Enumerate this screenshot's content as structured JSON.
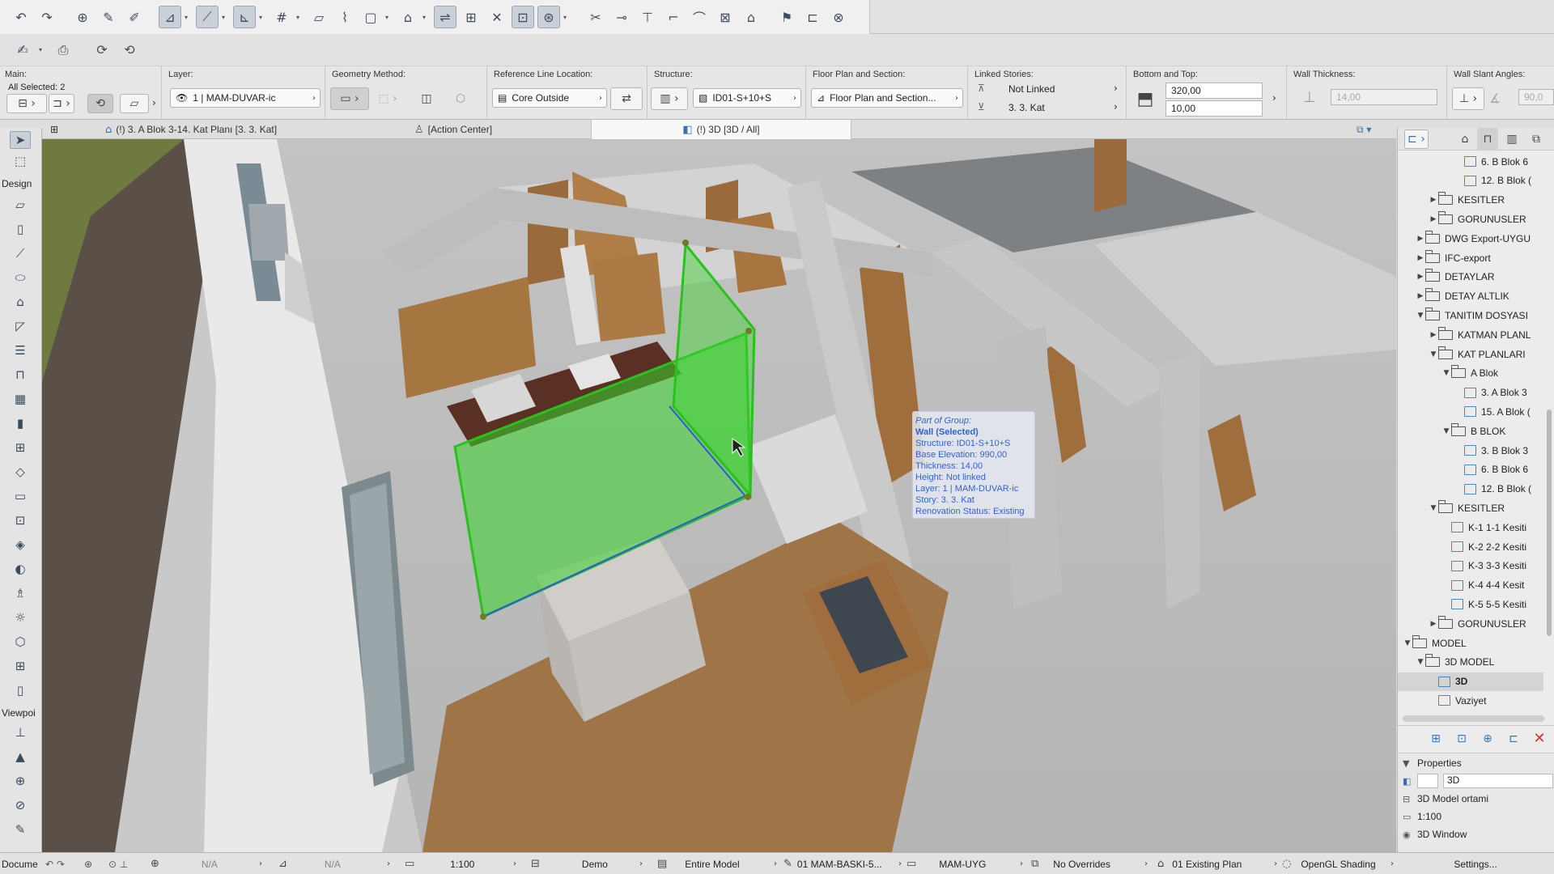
{
  "toolbar": {
    "icons": [
      "undo-icon",
      "redo-icon",
      "find-select-icon",
      "eyedropper-icon",
      "syringe-icon",
      "arrow-tool-icon",
      "guide-line-icon",
      "snap-guides-icon",
      "grid-snap-icon",
      "gravity-icon",
      "trace-icon",
      "suspend-groups-icon",
      "layers-icon",
      "renovation-icon",
      "story-icon",
      "fit-icon",
      "zoom-icon",
      "orbit-icon",
      "split-icon",
      "adjust-icon",
      "offset-icon",
      "curtain-icon",
      "trim-icon",
      "explode-icon",
      "home-icon",
      "flag-icon",
      "publish-icon",
      "teamwork-icon"
    ]
  },
  "infobox": {
    "main_title": "Main:",
    "main_selected": "All Selected: 2",
    "layer_title": "Layer:",
    "layer_value": "1 | MAM-DUVAR-ic",
    "geometry_title": "Geometry Method:",
    "refline_title": "Reference Line Location:",
    "refline_value": "Core Outside",
    "structure_title": "Structure:",
    "structure_value": "ID01-S+10+S",
    "floorplan_title": "Floor Plan and Section:",
    "floorplan_value": "Floor Plan and Section...",
    "linked_title": "Linked Stories:",
    "linked_top": "Not Linked",
    "linked_bottom": "3. 3. Kat",
    "bottomtop_title": "Bottom and Top:",
    "bottom_value": "320,00",
    "top_value": "10,00",
    "thickness_title": "Wall Thickness:",
    "thickness_value": "14,00",
    "slant_title": "Wall Slant Angles:",
    "slant_value": "90,0"
  },
  "tabs": {
    "plan": "(!) 3. A Blok 3-14. Kat Planı [3. 3. Kat]",
    "action": "[Action Center]",
    "view3d": "(!) 3D [3D / All]"
  },
  "toolbox": {
    "design_label": "Design",
    "viewpoint_label": "Viewpoi",
    "document_label": "Docume"
  },
  "tooltip": {
    "line1": "Part of Group:",
    "line2": "Wall (Selected)",
    "line3": "Structure: ID01-S+10+S",
    "line4": "Base Elevation: 990,00",
    "line5": "Thickness: 14,00",
    "line6": "Height: Not linked",
    "line7": "Layer: 1 | MAM-DUVAR-ic",
    "line8": "Story: 3. 3. Kat",
    "line9": "Renovation Status: Existing"
  },
  "navigator": {
    "items": [
      {
        "label": "6. B Blok 6",
        "type": "doc",
        "level": 6
      },
      {
        "label": "12. B Blok (",
        "type": "doc",
        "level": 6
      },
      {
        "label": "KESITLER",
        "type": "folder",
        "level": 4,
        "tri": "▶"
      },
      {
        "label": "GORUNUSLER",
        "type": "folder",
        "level": 4,
        "tri": "▶"
      },
      {
        "label": "DWG Export-UYGU",
        "type": "folder",
        "level": 3,
        "tri": "▶"
      },
      {
        "label": "IFC-export",
        "type": "folder",
        "level": 3,
        "tri": "▶"
      },
      {
        "label": "DETAYLAR",
        "type": "folder",
        "level": 3,
        "tri": "▶"
      },
      {
        "label": "DETAY ALTLIK",
        "type": "folder",
        "level": 3,
        "tri": "▶"
      },
      {
        "label": "TANITIM DOSYASI",
        "type": "folder",
        "level": 3,
        "tri": "▼"
      },
      {
        "label": "KATMAN PLANL",
        "type": "folder",
        "level": 4,
        "tri": "▶"
      },
      {
        "label": "KAT PLANLARI",
        "type": "folder",
        "level": 4,
        "tri": "▼"
      },
      {
        "label": "A Blok",
        "type": "folder",
        "level": 5,
        "tri": "▼"
      },
      {
        "label": "3. A Blok 3",
        "type": "doc",
        "level": 6
      },
      {
        "label": "15. A Blok (",
        "type": "doc",
        "level": 6
      },
      {
        "label": "B BLOK",
        "type": "folder",
        "level": 5,
        "tri": "▼"
      },
      {
        "label": "3. B Blok 3",
        "type": "doc",
        "level": 6
      },
      {
        "label": "6. B Blok 6",
        "type": "doc",
        "level": 6
      },
      {
        "label": "12. B Blok (",
        "type": "doc",
        "level": 6
      },
      {
        "label": "KESITLER",
        "type": "folder",
        "level": 4,
        "tri": "▼"
      },
      {
        "label": "K-1 1-1 Kesiti",
        "type": "doc",
        "level": 5
      },
      {
        "label": "K-2 2-2 Kesiti",
        "type": "doc",
        "level": 5
      },
      {
        "label": "K-3 3-3 Kesiti",
        "type": "doc",
        "level": 5
      },
      {
        "label": "K-4 4-4 Kesit",
        "type": "doc",
        "level": 5
      },
      {
        "label": "K-5 5-5 Kesiti",
        "type": "doc",
        "level": 5
      },
      {
        "label": "GORUNUSLER",
        "type": "folder",
        "level": 4,
        "tri": "▶"
      },
      {
        "label": "MODEL",
        "type": "folder",
        "level": 2,
        "tri": "▼"
      },
      {
        "label": "3D MODEL",
        "type": "folder",
        "level": 3,
        "tri": "▼"
      },
      {
        "label": "3D",
        "type": "doc",
        "level": 4,
        "selected": true
      },
      {
        "label": "Vaziyet",
        "type": "doc",
        "level": 4
      }
    ],
    "properties_title": "Properties",
    "prop_name": "3D",
    "prop_model": "3D Model ortami",
    "prop_scale": "1:100",
    "prop_window": "3D Window",
    "settings_label": "Settings..."
  },
  "statusbar": {
    "na1": "N/A",
    "na2": "N/A",
    "scale": "1:100",
    "layer_combo": "Demo",
    "model_view": "Entire Model",
    "pen_set": "01 MAM-BASKI-5...",
    "mvo": "MAM-UYG",
    "overrides": "No Overrides",
    "renovation": "01 Existing Plan",
    "engine": "OpenGL Shading"
  },
  "colors": {
    "selection_green": "#39d32c",
    "tooltip_blue": "#2f63d8",
    "accent_blue": "#3a6fb0"
  }
}
